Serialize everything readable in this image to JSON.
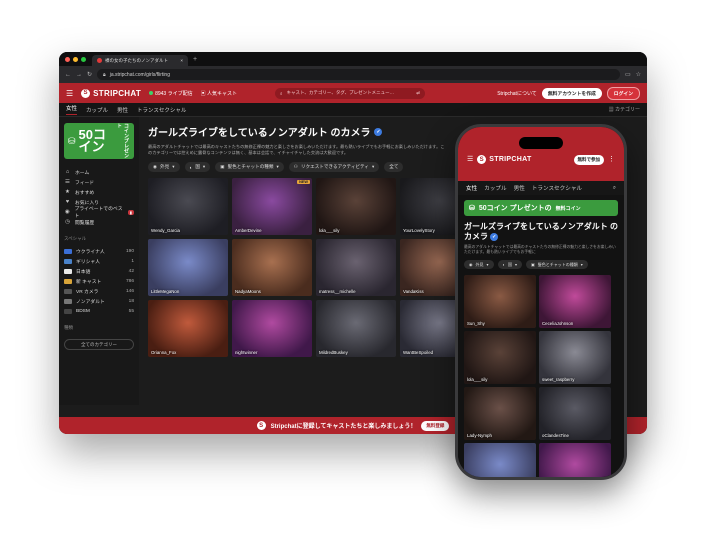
{
  "browser": {
    "tab_title": "裸の女の子たちのノンアダルト",
    "url": "ja.stripchat.com/girls/flirting"
  },
  "site": {
    "logo_text": "STRIPCHAT",
    "live_count": "8943 ライブ配信",
    "popular_label": "人気キャスト",
    "search_placeholder": "キャスト、カテゴリー、タグ、プレゼントメニュー…",
    "about_link": "Stripchatについて",
    "create_account": "無料アカウントを作成",
    "login": "ログイン",
    "brand_color": "#b0232b",
    "accent_green": "#3b9b3e"
  },
  "subnav": {
    "tabs": [
      "女性",
      "カップル",
      "男性",
      "トランスセクシャル"
    ],
    "active": "女性",
    "categories": "カテゴリー"
  },
  "sidebar": {
    "coin_big": "50コイン",
    "coin_side": "コインプレゼント",
    "items": [
      {
        "icon": "home-icon",
        "glyph": "⌂",
        "label": "ホーム"
      },
      {
        "icon": "feed-icon",
        "glyph": "☰",
        "label": "フィード"
      },
      {
        "icon": "recommend-icon",
        "glyph": "★",
        "label": "おすすめ"
      },
      {
        "icon": "heart-icon",
        "glyph": "♥",
        "label": "お気に入り"
      },
      {
        "icon": "private-icon",
        "glyph": "◉",
        "label": "プライベートでのベスト"
      },
      {
        "icon": "history-icon",
        "glyph": "◷",
        "label": "閲覧履歴"
      }
    ],
    "special_title": "スペシャル",
    "special": [
      {
        "label": "ウクライナ人",
        "count": "190",
        "flag": "#3b6fd6"
      },
      {
        "label": "ギリシャ人",
        "count": "1",
        "flag": "#4a82c9"
      },
      {
        "label": "日本語",
        "count": "42",
        "flag": "#e9e9e9"
      },
      {
        "label": "新 キャスト",
        "count": "786",
        "flag": "#d9a53a"
      },
      {
        "label": "VR カメラ",
        "count": "146",
        "flag": "#555555"
      },
      {
        "label": "ノンアダルト",
        "count": "18",
        "flag": "#777777"
      },
      {
        "label": "BDSM",
        "count": "55",
        "flag": "#444444"
      }
    ],
    "types_title": "種類",
    "all_categories": "全てのカテゴリー"
  },
  "main": {
    "title": "ガールズライブをしているノンアダルト のカメラ",
    "description": "最高のアダルトチャットでは最高のキャストたちの無修正裸の魅力と楽しさをお楽しみいただけます。最も熱いライブでもお手軽にお楽しみいただけます。このカテゴリーでは控えめに露骨なコンテンツは無く、基本は会話で、イチャイチャした交流は大歓迎です。",
    "filters": [
      "外見",
      "国",
      "髪色とチャットの種類",
      "リクエストできるアクティビティ",
      "全て"
    ],
    "thumbs": [
      {
        "name": "Wendy_Garcia",
        "new": false,
        "c1": "#4a4a52",
        "c2": "#1e1e24"
      },
      {
        "name": "AmberDevine",
        "new": true,
        "c1": "#8a4aa0",
        "c2": "#3a2040"
      },
      {
        "name": "lola___sily",
        "new": false,
        "c1": "#5a4238",
        "c2": "#201614"
      },
      {
        "name": "YourLovelyStory",
        "new": true,
        "c1": "#3e3e44",
        "c2": "#19191c"
      },
      {
        "name": "LittleMegaNon",
        "new": false,
        "c1": "#7a8ac8",
        "c2": "#3a3e60"
      },
      {
        "name": "NadyaMoons",
        "new": false,
        "c1": "#a87050",
        "c2": "#4a2c1e"
      },
      {
        "name": "matress__michelle",
        "new": false,
        "c1": "#6a6270",
        "c2": "#2a2630"
      },
      {
        "name": "VandaKiss",
        "new": false,
        "c1": "#9a6a54",
        "c2": "#3a2620"
      },
      {
        "name": "Orianna_Fox",
        "new": false,
        "c1": "#c05a3c",
        "c2": "#4a1e12"
      },
      {
        "name": "nightwinner",
        "new": false,
        "c1": "#b04aa0",
        "c2": "#40184a"
      },
      {
        "name": "MildredBuskey",
        "new": false,
        "c1": "#6a6a74",
        "c2": "#28282e"
      },
      {
        "name": "WantBeSpoiled",
        "new": false,
        "c1": "#7a7a8a",
        "c2": "#2a2a34"
      }
    ]
  },
  "bottom_bar": {
    "text": "Stripchatに登録してキャストたちと楽しみましょう！",
    "button": "無料登録"
  },
  "phone": {
    "logo_text": "STRIPCHAT",
    "join": "無料で参加",
    "tabs": [
      "女性",
      "カップル",
      "男性",
      "トランスセクシャル"
    ],
    "coin_text": "50コイン プレゼントの",
    "coin_free": "無料コイン",
    "title": "ガールズライブをしているノンアダルト のカメラ",
    "description": "最高のアダルトチャットでは最高のキャストたちの無修正裸の魅力と楽しさをお楽しみいただけます。最も熱いライブでもお手軽に",
    "filters": [
      "外見",
      "国",
      "髪色とチャットの種類"
    ],
    "thumbs": [
      {
        "name": "Sun_Shy",
        "c1": "#8a5a44",
        "c2": "#2e1c16"
      },
      {
        "name": "CeceliaJohnson",
        "c1": "#c04a9a",
        "c2": "#3e1636"
      },
      {
        "name": "lola___sily",
        "c1": "#5a4238",
        "c2": "#201614"
      },
      {
        "name": "sweet_raspberry",
        "c1": "#8a8a94",
        "c2": "#34343c"
      },
      {
        "name": "Lady-Nymph",
        "c1": "#6a5048",
        "c2": "#221814"
      },
      {
        "name": "oClandesTine",
        "c1": "#5a5a64",
        "c2": "#222228"
      },
      {
        "name": "",
        "c1": "#7a8ac8",
        "c2": "#3a3e60"
      },
      {
        "name": "",
        "c1": "#b04aa0",
        "c2": "#40184a"
      }
    ]
  }
}
